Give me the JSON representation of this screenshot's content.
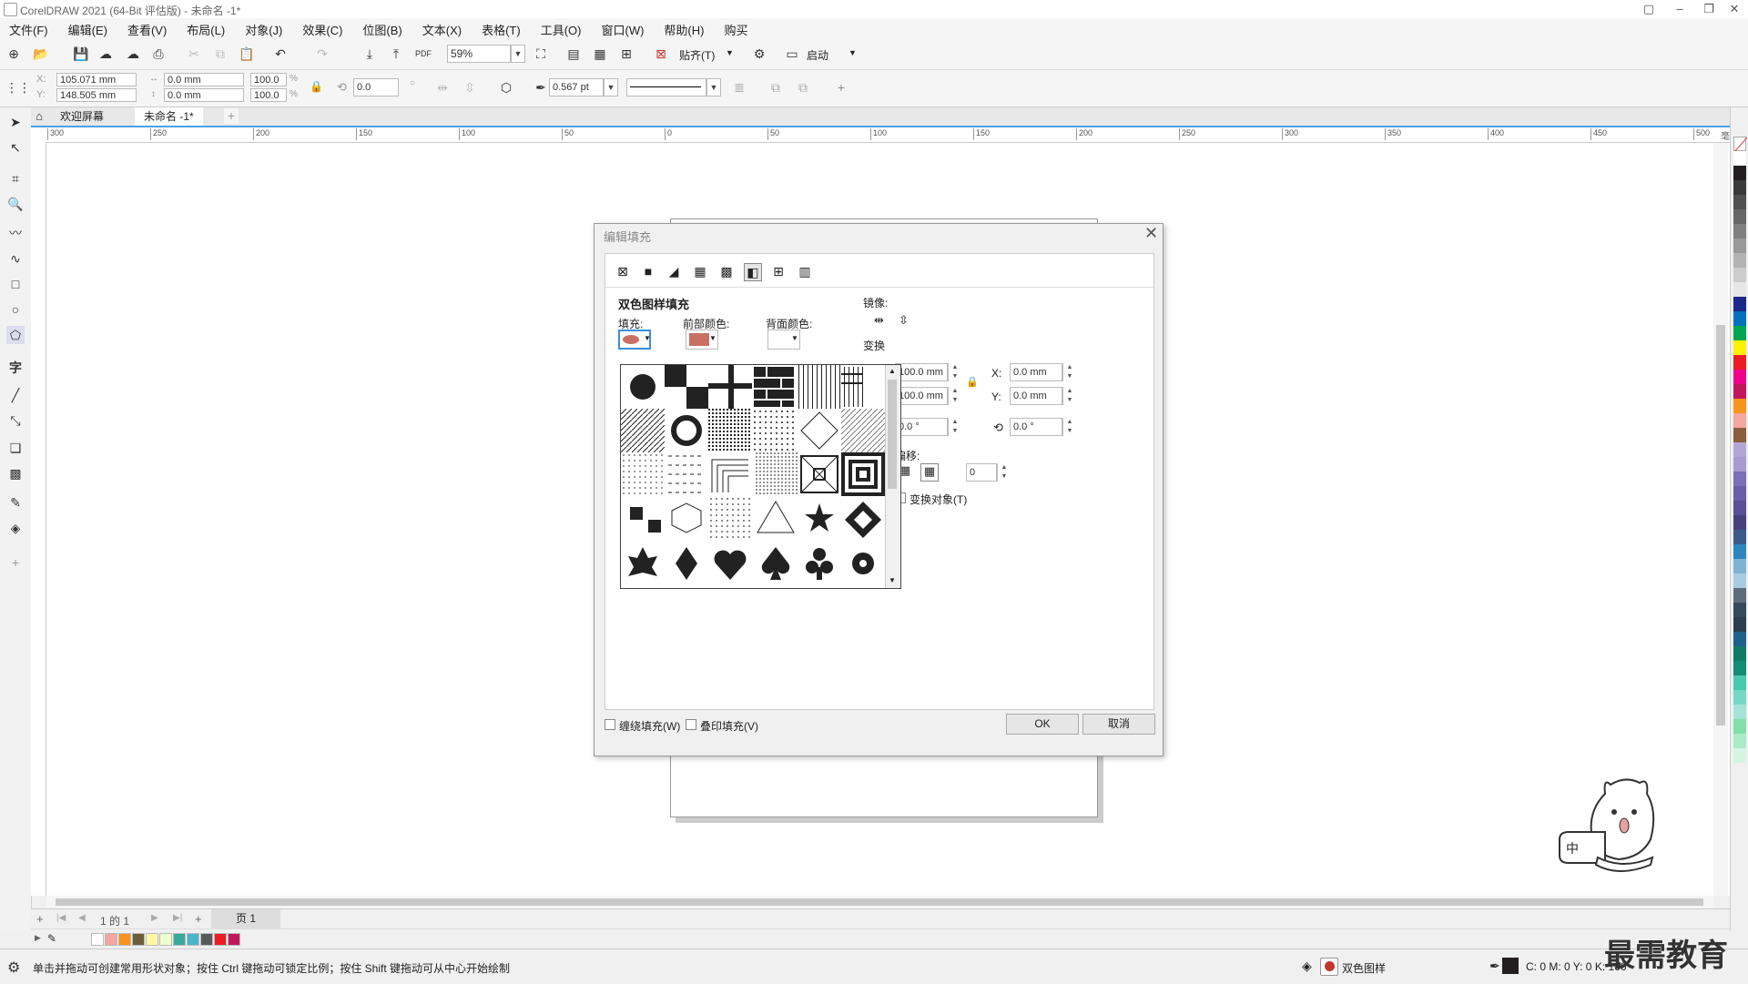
{
  "window": {
    "title": "CorelDRAW 2021 (64-Bit 评估版) - 未命名 -1*"
  },
  "menu": [
    "文件(F)",
    "编辑(E)",
    "查看(V)",
    "布局(L)",
    "对象(J)",
    "效果(C)",
    "位图(B)",
    "文本(X)",
    "表格(T)",
    "工具(O)",
    "窗口(W)",
    "帮助(H)",
    "购买"
  ],
  "toolbar": {
    "zoom": "59%",
    "snap_label": "贴齐(T)",
    "launch_label": "启动"
  },
  "props": {
    "x": "105.071 mm",
    "y": "148.505 mm",
    "w": "0.0 mm",
    "h": "0.0 mm",
    "sx": "100.0",
    "sy": "100.0",
    "pct": "%",
    "rotation": "0.0",
    "outline": "0.567 pt"
  },
  "tabs": {
    "welcome": "欢迎屏幕",
    "doc": "未命名 -1*"
  },
  "ruler": {
    "h_ticks": [
      "300",
      "250",
      "200",
      "150",
      "100",
      "50",
      "0",
      "50",
      "100",
      "150",
      "200",
      "250",
      "300",
      "350",
      "400",
      "450",
      "500"
    ],
    "h_unit": "毫米"
  },
  "dialog": {
    "title": "编辑填充",
    "section_title": "双色图样填充",
    "fill_label": "填充:",
    "fore_label": "前部颜色:",
    "back_label": "背面颜色:",
    "mirror_label": "镜像:",
    "transform_label": "变换",
    "width": "100.0 mm",
    "height": "100.0 mm",
    "x_label": "X:",
    "x": "0.0 mm",
    "y_label": "Y:",
    "y": "0.0 mm",
    "skew": "0.0 °",
    "rotate": "0.0 °",
    "offset_label": "偏移:",
    "offset_value": "0",
    "transform_obj_label": "变换对象(T)",
    "wrap_label": "缠绕填充(W)",
    "overprint_label": "叠印填充(V)",
    "ok": "OK",
    "cancel": "取消",
    "fore_color": "#c97065",
    "back_color": "#ffffff"
  },
  "pagenav": {
    "page_counter": "1 的 1",
    "page_tab": "页 1"
  },
  "status": {
    "hint": "单击并拖动可创建常用形状对象；按住 Ctrl 键拖动可锁定比例；按住 Shift 键拖动可从中心开始绘制",
    "fill_name": "双色图样",
    "cmyk": "C: 0 M: 0 Y: 0 K: 100"
  },
  "mascot": {
    "text": "中"
  },
  "watermark": "最需教育",
  "colors": {
    "palette": [
      "#ffffff",
      "#231f20",
      "#3a3a3a",
      "#505050",
      "#666",
      "#808080",
      "#999",
      "#b3b3b3",
      "#ccc",
      "#e6e6e6",
      "#1b2a8a",
      "#0072bc",
      "#00a650",
      "#fff200",
      "#ed1c24",
      "#ec008c",
      "#c2185b",
      "#f7941d",
      "#f4a6a0",
      "#8b5e3c",
      "#b3a6d6",
      "#a89bd1",
      "#7b6fb5",
      "#6b5ea8",
      "#5a4f94",
      "#47407d",
      "#3a5a8c",
      "#2e86c1",
      "#7fb3d5",
      "#a9cce3",
      "#5d6d7e",
      "#34495e",
      "#2c3e50",
      "#1f618d",
      "#117a65",
      "#138d75",
      "#48c9b0",
      "#76d7c4",
      "#a3e4d7",
      "#82e0aa",
      "#abebc6",
      "#d5f5e3"
    ],
    "docpal": [
      "#ffffff",
      "#f4a6a0",
      "#f7941d",
      "#6b5e3c",
      "#fff7a8",
      "#f0ffd0",
      "#3aa89b",
      "#49b6c8",
      "#5a5a5a",
      "#ed1c24",
      "#c2185b"
    ]
  }
}
